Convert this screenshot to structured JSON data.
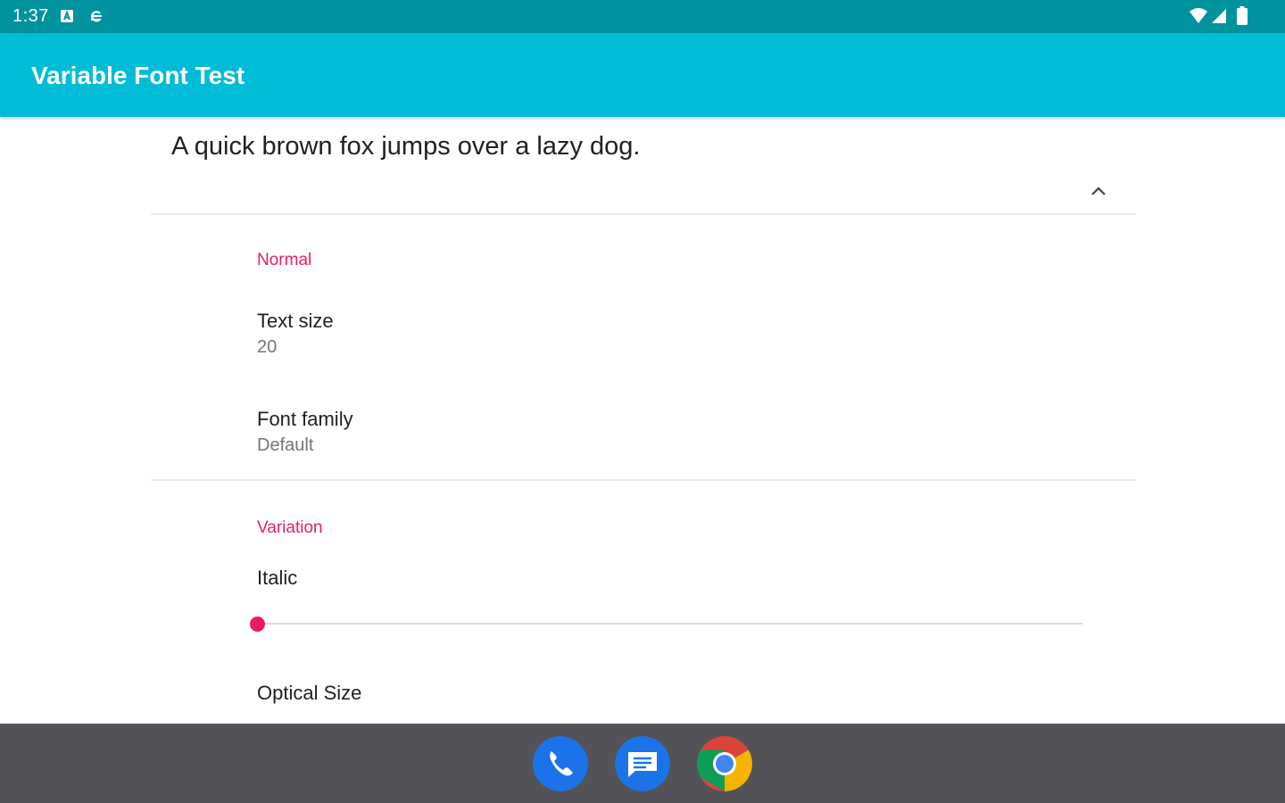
{
  "status_bar": {
    "time": "1:37",
    "left_icons": [
      "notification-a-icon",
      "sync-icon"
    ],
    "right_icons": [
      "wifi-icon",
      "cell-signal-icon",
      "battery-icon"
    ]
  },
  "app_bar": {
    "title": "Variable Font Test",
    "color": "#00bcd6"
  },
  "preview": {
    "text": "A quick brown fox jumps over a lazy dog."
  },
  "sections": {
    "normal": {
      "title": "Normal",
      "text_size": {
        "title": "Text size",
        "summary": "20"
      },
      "font_family": {
        "title": "Font family",
        "summary": "Default"
      }
    },
    "variation": {
      "title": "Variation",
      "italic": {
        "title": "Italic",
        "value_fraction": 0.0
      },
      "optical_size": {
        "title": "Optical Size"
      }
    }
  },
  "accent_color": "#e91e63",
  "dock": {
    "icons": [
      "phone-app-icon",
      "messages-app-icon",
      "chrome-app-icon"
    ]
  }
}
